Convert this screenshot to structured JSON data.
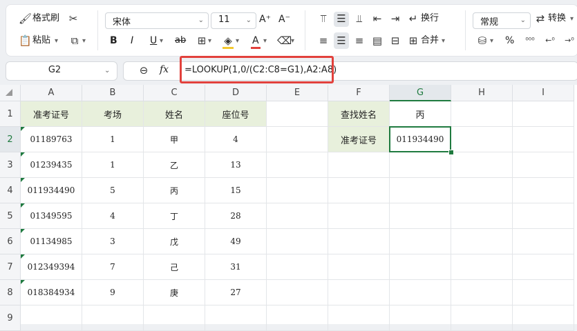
{
  "ribbon": {
    "format_painter": "格式刷",
    "paste": "粘贴",
    "font_name": "宋体",
    "font_size": "11",
    "wrap": "换行",
    "merge": "合并",
    "number_format": "常规",
    "convert": "转换",
    "bold": "B",
    "italic": "I",
    "underline": "U",
    "strike": "ab",
    "font_color_glyph": "A",
    "grow_glyph": "A⁺",
    "shrink_glyph": "A⁻",
    "percent": "%"
  },
  "namebox": {
    "value": "G2"
  },
  "formula": {
    "fx": "fx",
    "value": "=LOOKUP(1,0/(C2:C8=G1),A2:A8)"
  },
  "columns": [
    "A",
    "B",
    "C",
    "D",
    "E",
    "F",
    "G",
    "H",
    "I"
  ],
  "rows": [
    "1",
    "2",
    "3",
    "4",
    "5",
    "6",
    "7",
    "8",
    "9"
  ],
  "table": {
    "headers": [
      "准考证号",
      "考场",
      "姓名",
      "座位号"
    ],
    "data": [
      [
        "01189763",
        "1",
        "甲",
        "4"
      ],
      [
        "01239435",
        "1",
        "乙",
        "13"
      ],
      [
        "011934490",
        "5",
        "丙",
        "15"
      ],
      [
        "01349595",
        "4",
        "丁",
        "28"
      ],
      [
        "01134985",
        "3",
        "戊",
        "49"
      ],
      [
        "012349394",
        "7",
        "己",
        "31"
      ],
      [
        "018384934",
        "9",
        "庚",
        "27"
      ]
    ]
  },
  "lookup": {
    "f1": "查找姓名",
    "g1": "丙",
    "f2": "准考证号",
    "g2": "011934490"
  },
  "colors": {
    "accent": "#1f7a3f",
    "header_fill": "#e8f0dc",
    "highlight_box": "#e2413c"
  }
}
